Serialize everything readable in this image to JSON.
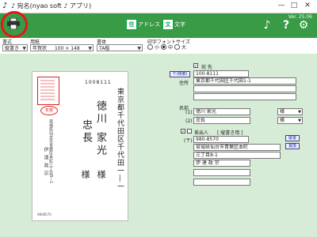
{
  "window": {
    "title": "♪ 宛名(nyao soft ♪ アプリ)",
    "min": "—",
    "max": "□",
    "close": "✕"
  },
  "toolbar": {
    "address_label": "アドレス",
    "text_label": "文字",
    "version": "Ver. 25.06"
  },
  "options": {
    "writing_label": "書式",
    "writing_value": "縦書き",
    "paper_label": "用紙",
    "paper_value": "年賀状",
    "paper_size": "100 × 148",
    "font_label": "書体",
    "font_value": "TA楷",
    "print_size_label": "印字フォントサイズ",
    "size_small": "小",
    "size_medium": "中",
    "size_large": "大"
  },
  "postcard": {
    "zip": "1008111",
    "address": "東京都千代田区千代田一―一",
    "name_line1": "徳川",
    "name_line2": "家光",
    "name_line3": "忠長",
    "honorific": "様",
    "sender_address": "宮城県仙台市青葉区本町三丁目8―1",
    "sender_name": "伊達政宗",
    "sender_zip": "9808570",
    "nenga": "年賀"
  },
  "form": {
    "recipient_label": "宛 先",
    "zip_button": "〒(検索)",
    "zip_value": "100-8111",
    "address_label": "住所",
    "address_value": "東京都千代田区千代田1-1",
    "name_label": "名前",
    "name1_num": "(1)",
    "name2_num": "(2)",
    "name1_value": "徳川  家光",
    "name2_value": "忠長",
    "honorific1": "様",
    "honorific2": "様",
    "sender_label": "差出人",
    "sender_note": "[ 縦書き用 ]",
    "sender_zip_label": "(〒)",
    "sender_zip_value": "980-8570",
    "sender_address_value": "宮城県仙台市青葉区本町",
    "sender_address2_value": "三丁目8-1",
    "sender_name_value": "伊 達  政 宗",
    "btn_vertical": "縦書",
    "btn_replace": "置換"
  }
}
